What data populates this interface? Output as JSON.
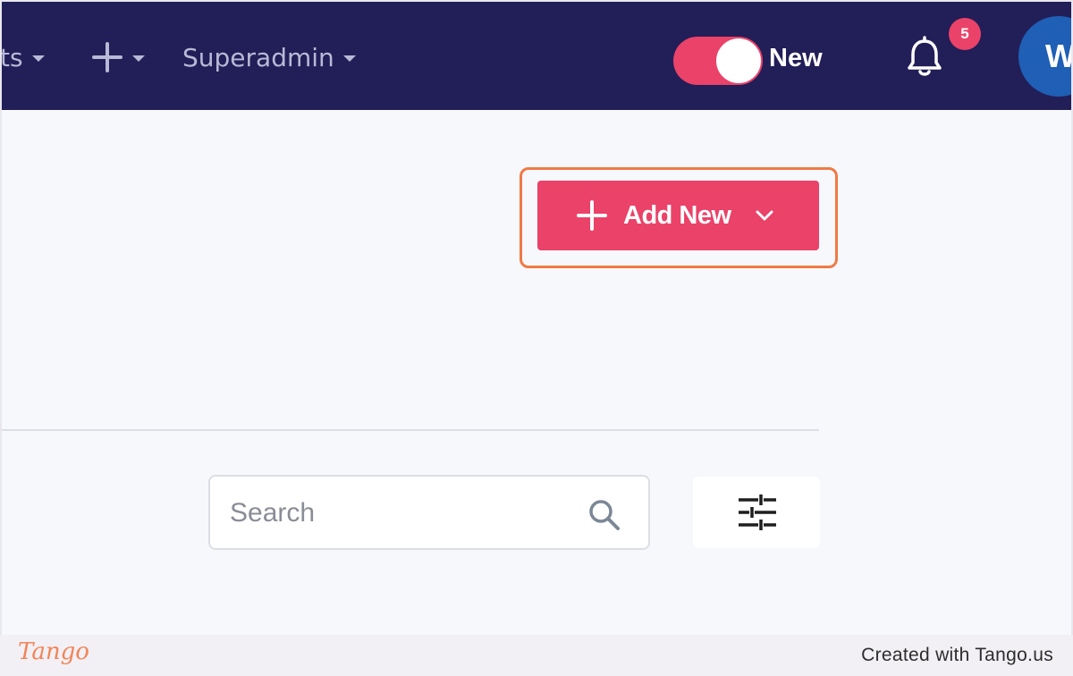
{
  "nav": {
    "partial_item": "ts",
    "superadmin_label": "Superadmin"
  },
  "toggle": {
    "label": "New",
    "state": "on"
  },
  "notifications": {
    "count": "5"
  },
  "avatar": {
    "initial": "W"
  },
  "actions": {
    "add_new_label": "Add New"
  },
  "search": {
    "placeholder": "Search"
  },
  "footer": {
    "logo_text": "Tango",
    "credit": "Created with Tango.us"
  },
  "colors": {
    "nav_bg": "#221e57",
    "accent": "#ea4269",
    "highlight": "#f07a45",
    "avatar": "#1f5fb5"
  }
}
